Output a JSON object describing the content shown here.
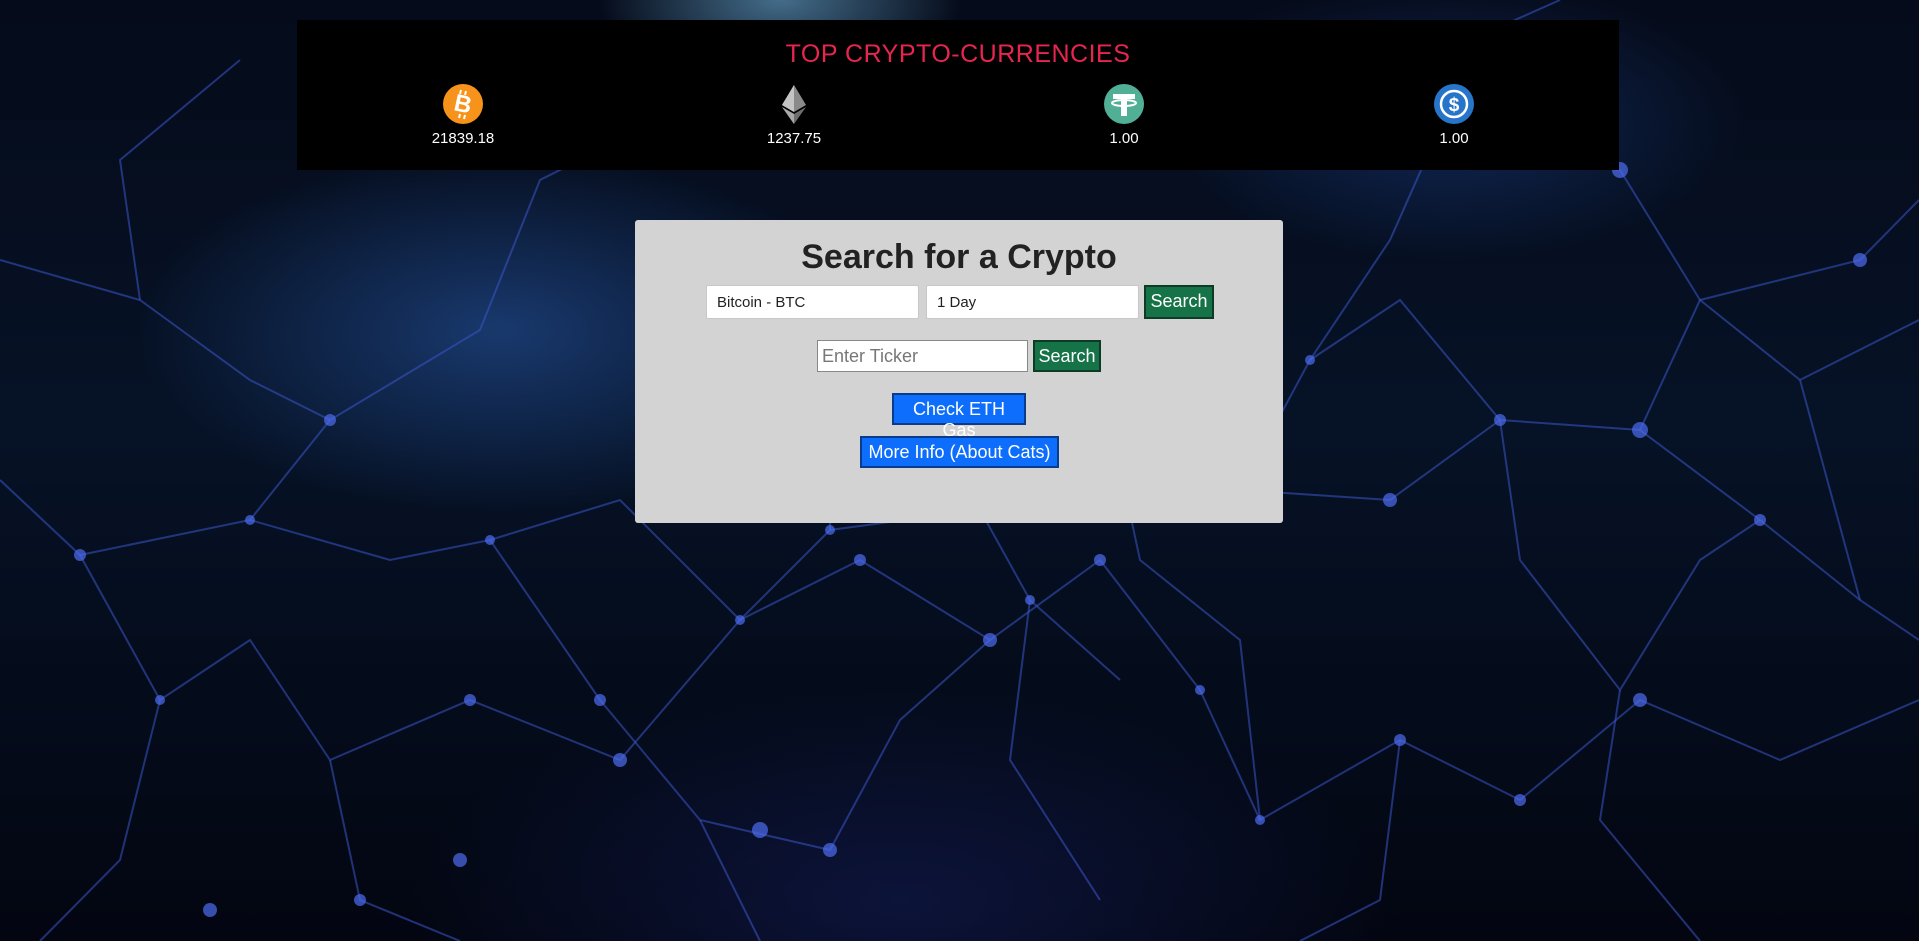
{
  "banner": {
    "title": "TOP CRYPTO-CURRENCIES",
    "coins": [
      {
        "icon": "bitcoin-icon",
        "price": "21839.18",
        "color": "#f7931a"
      },
      {
        "icon": "ethereum-icon",
        "price": "1237.75",
        "color": "#3c3c3d"
      },
      {
        "icon": "tether-icon",
        "price": "1.00",
        "color": "#50af95"
      },
      {
        "icon": "usd-coin-icon",
        "price": "1.00",
        "color": "#2775ca"
      }
    ]
  },
  "search": {
    "title": "Search for a Crypto",
    "coin_select": "Bitcoin - BTC",
    "period_select": "1 Day",
    "search_label": "Search",
    "ticker_placeholder": "Enter Ticker",
    "ticker_search_label": "Search",
    "eth_gas_label": "Check ETH Gas",
    "more_info_label": "More Info (About Cats)"
  },
  "colors": {
    "title_red": "#e8254f",
    "panel_bg": "#d3d3d3",
    "green_button": "#157347",
    "blue_button": "#0d6efd"
  }
}
